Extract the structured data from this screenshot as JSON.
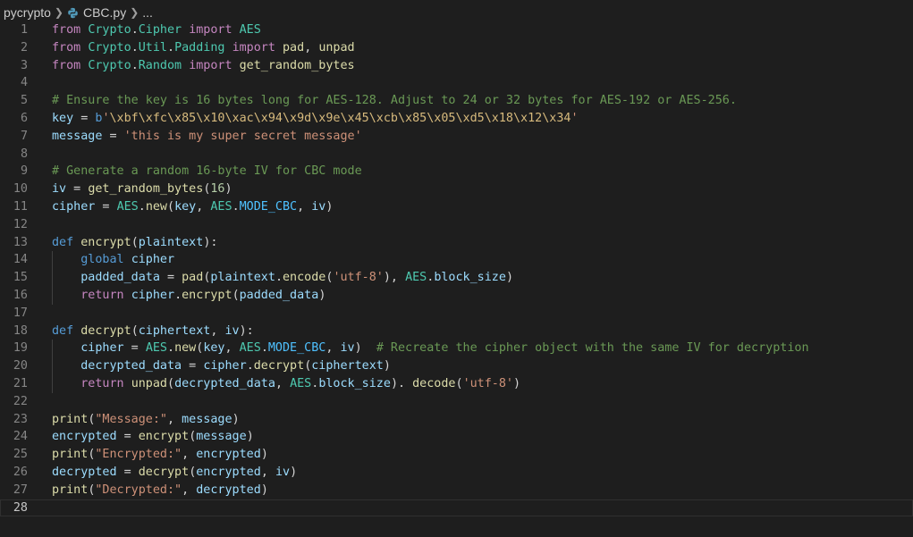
{
  "breadcrumb": {
    "folder": "pycrypto",
    "file": "CBC.py",
    "more": "..."
  },
  "editor": {
    "current_line": 28,
    "lines": [
      {
        "n": "1",
        "indent": 0,
        "tokens": [
          [
            "kw",
            "from"
          ],
          [
            "op",
            " "
          ],
          [
            "cls",
            "Crypto"
          ],
          [
            "op",
            "."
          ],
          [
            "cls",
            "Cipher"
          ],
          [
            "op",
            " "
          ],
          [
            "kw",
            "import"
          ],
          [
            "op",
            " "
          ],
          [
            "cls",
            "AES"
          ]
        ]
      },
      {
        "n": "2",
        "indent": 0,
        "tokens": [
          [
            "kw",
            "from"
          ],
          [
            "op",
            " "
          ],
          [
            "cls",
            "Crypto"
          ],
          [
            "op",
            "."
          ],
          [
            "cls",
            "Util"
          ],
          [
            "op",
            "."
          ],
          [
            "cls",
            "Padding"
          ],
          [
            "op",
            " "
          ],
          [
            "kw",
            "import"
          ],
          [
            "op",
            " "
          ],
          [
            "fn",
            "pad"
          ],
          [
            "op",
            ", "
          ],
          [
            "fn",
            "unpad"
          ]
        ]
      },
      {
        "n": "3",
        "indent": 0,
        "tokens": [
          [
            "kw",
            "from"
          ],
          [
            "op",
            " "
          ],
          [
            "cls",
            "Crypto"
          ],
          [
            "op",
            "."
          ],
          [
            "cls",
            "Random"
          ],
          [
            "op",
            " "
          ],
          [
            "kw",
            "import"
          ],
          [
            "op",
            " "
          ],
          [
            "fn",
            "get_random_bytes"
          ]
        ]
      },
      {
        "n": "4",
        "indent": 0,
        "tokens": []
      },
      {
        "n": "5",
        "indent": 0,
        "tokens": [
          [
            "cm",
            "# Ensure the key is 16 bytes long for AES-128. Adjust to 24 or 32 bytes for AES-192 or AES-256."
          ]
        ]
      },
      {
        "n": "6",
        "indent": 0,
        "tokens": [
          [
            "var",
            "key"
          ],
          [
            "op",
            " = "
          ],
          [
            "kb",
            "b"
          ],
          [
            "str",
            "'"
          ],
          [
            "esc",
            "\\xbf\\xfc\\x85\\x10\\xac\\x94\\x9d\\x9e\\x45\\xcb\\x85\\x05\\xd5\\x18\\x12\\x34"
          ],
          [
            "str",
            "'"
          ]
        ]
      },
      {
        "n": "7",
        "indent": 0,
        "tokens": [
          [
            "var",
            "message"
          ],
          [
            "op",
            " = "
          ],
          [
            "str",
            "'this is my super secret message'"
          ]
        ]
      },
      {
        "n": "8",
        "indent": 0,
        "tokens": []
      },
      {
        "n": "9",
        "indent": 0,
        "tokens": [
          [
            "cm",
            "# Generate a random 16-byte IV for CBC mode"
          ]
        ]
      },
      {
        "n": "10",
        "indent": 0,
        "tokens": [
          [
            "var",
            "iv"
          ],
          [
            "op",
            " = "
          ],
          [
            "fn",
            "get_random_bytes"
          ],
          [
            "op",
            "("
          ],
          [
            "num",
            "16"
          ],
          [
            "op",
            ")"
          ]
        ]
      },
      {
        "n": "11",
        "indent": 0,
        "tokens": [
          [
            "var",
            "cipher"
          ],
          [
            "op",
            " = "
          ],
          [
            "cls",
            "AES"
          ],
          [
            "op",
            "."
          ],
          [
            "fn",
            "new"
          ],
          [
            "op",
            "("
          ],
          [
            "var",
            "key"
          ],
          [
            "op",
            ", "
          ],
          [
            "cls",
            "AES"
          ],
          [
            "op",
            "."
          ],
          [
            "const",
            "MODE_CBC"
          ],
          [
            "op",
            ", "
          ],
          [
            "var",
            "iv"
          ],
          [
            "op",
            ")"
          ]
        ]
      },
      {
        "n": "12",
        "indent": 0,
        "tokens": []
      },
      {
        "n": "13",
        "indent": 0,
        "tokens": [
          [
            "kb",
            "def"
          ],
          [
            "op",
            " "
          ],
          [
            "fn",
            "encrypt"
          ],
          [
            "op",
            "("
          ],
          [
            "var",
            "plaintext"
          ],
          [
            "op",
            "):"
          ]
        ]
      },
      {
        "n": "14",
        "indent": 1,
        "tokens": [
          [
            "op",
            "    "
          ],
          [
            "kb",
            "global"
          ],
          [
            "op",
            " "
          ],
          [
            "var",
            "cipher"
          ]
        ]
      },
      {
        "n": "15",
        "indent": 1,
        "tokens": [
          [
            "op",
            "    "
          ],
          [
            "var",
            "padded_data"
          ],
          [
            "op",
            " = "
          ],
          [
            "fn",
            "pad"
          ],
          [
            "op",
            "("
          ],
          [
            "var",
            "plaintext"
          ],
          [
            "op",
            "."
          ],
          [
            "fn",
            "encode"
          ],
          [
            "op",
            "("
          ],
          [
            "str",
            "'utf-8'"
          ],
          [
            "op",
            "), "
          ],
          [
            "cls",
            "AES"
          ],
          [
            "op",
            "."
          ],
          [
            "var",
            "block_size"
          ],
          [
            "op",
            ")"
          ]
        ]
      },
      {
        "n": "16",
        "indent": 1,
        "tokens": [
          [
            "op",
            "    "
          ],
          [
            "kw",
            "return"
          ],
          [
            "op",
            " "
          ],
          [
            "var",
            "cipher"
          ],
          [
            "op",
            "."
          ],
          [
            "fn",
            "encrypt"
          ],
          [
            "op",
            "("
          ],
          [
            "var",
            "padded_data"
          ],
          [
            "op",
            ")"
          ]
        ]
      },
      {
        "n": "17",
        "indent": 0,
        "tokens": []
      },
      {
        "n": "18",
        "indent": 0,
        "tokens": [
          [
            "kb",
            "def"
          ],
          [
            "op",
            " "
          ],
          [
            "fn",
            "decrypt"
          ],
          [
            "op",
            "("
          ],
          [
            "var",
            "ciphertext"
          ],
          [
            "op",
            ", "
          ],
          [
            "var",
            "iv"
          ],
          [
            "op",
            "):"
          ]
        ]
      },
      {
        "n": "19",
        "indent": 1,
        "tokens": [
          [
            "op",
            "    "
          ],
          [
            "var",
            "cipher"
          ],
          [
            "op",
            " = "
          ],
          [
            "cls",
            "AES"
          ],
          [
            "op",
            "."
          ],
          [
            "fn",
            "new"
          ],
          [
            "op",
            "("
          ],
          [
            "var",
            "key"
          ],
          [
            "op",
            ", "
          ],
          [
            "cls",
            "AES"
          ],
          [
            "op",
            "."
          ],
          [
            "const",
            "MODE_CBC"
          ],
          [
            "op",
            ", "
          ],
          [
            "var",
            "iv"
          ],
          [
            "op",
            ")  "
          ],
          [
            "cm",
            "# Recreate the cipher object with the same IV for decryption"
          ]
        ]
      },
      {
        "n": "20",
        "indent": 1,
        "tokens": [
          [
            "op",
            "    "
          ],
          [
            "var",
            "decrypted_data"
          ],
          [
            "op",
            " = "
          ],
          [
            "var",
            "cipher"
          ],
          [
            "op",
            "."
          ],
          [
            "fn",
            "decrypt"
          ],
          [
            "op",
            "("
          ],
          [
            "var",
            "ciphertext"
          ],
          [
            "op",
            ")"
          ]
        ]
      },
      {
        "n": "21",
        "indent": 1,
        "tokens": [
          [
            "op",
            "    "
          ],
          [
            "kw",
            "return"
          ],
          [
            "op",
            " "
          ],
          [
            "fn",
            "unpad"
          ],
          [
            "op",
            "("
          ],
          [
            "var",
            "decrypted_data"
          ],
          [
            "op",
            ", "
          ],
          [
            "cls",
            "AES"
          ],
          [
            "op",
            "."
          ],
          [
            "var",
            "block_size"
          ],
          [
            "op",
            "). "
          ],
          [
            "fn",
            "decode"
          ],
          [
            "op",
            "("
          ],
          [
            "str",
            "'utf-8'"
          ],
          [
            "op",
            ")"
          ]
        ]
      },
      {
        "n": "22",
        "indent": 0,
        "tokens": []
      },
      {
        "n": "23",
        "indent": 0,
        "tokens": [
          [
            "fn",
            "print"
          ],
          [
            "op",
            "("
          ],
          [
            "str",
            "\"Message:\""
          ],
          [
            "op",
            ", "
          ],
          [
            "var",
            "message"
          ],
          [
            "op",
            ")"
          ]
        ]
      },
      {
        "n": "24",
        "indent": 0,
        "tokens": [
          [
            "var",
            "encrypted"
          ],
          [
            "op",
            " = "
          ],
          [
            "fn",
            "encrypt"
          ],
          [
            "op",
            "("
          ],
          [
            "var",
            "message"
          ],
          [
            "op",
            ")"
          ]
        ]
      },
      {
        "n": "25",
        "indent": 0,
        "tokens": [
          [
            "fn",
            "print"
          ],
          [
            "op",
            "("
          ],
          [
            "str",
            "\"Encrypted:\""
          ],
          [
            "op",
            ", "
          ],
          [
            "var",
            "encrypted"
          ],
          [
            "op",
            ")"
          ]
        ]
      },
      {
        "n": "26",
        "indent": 0,
        "tokens": [
          [
            "var",
            "decrypted"
          ],
          [
            "op",
            " = "
          ],
          [
            "fn",
            "decrypt"
          ],
          [
            "op",
            "("
          ],
          [
            "var",
            "encrypted"
          ],
          [
            "op",
            ", "
          ],
          [
            "var",
            "iv"
          ],
          [
            "op",
            ")"
          ]
        ]
      },
      {
        "n": "27",
        "indent": 0,
        "tokens": [
          [
            "fn",
            "print"
          ],
          [
            "op",
            "("
          ],
          [
            "str",
            "\"Decrypted:\""
          ],
          [
            "op",
            ", "
          ],
          [
            "var",
            "decrypted"
          ],
          [
            "op",
            ")"
          ]
        ]
      },
      {
        "n": "28",
        "indent": 0,
        "tokens": []
      }
    ]
  }
}
